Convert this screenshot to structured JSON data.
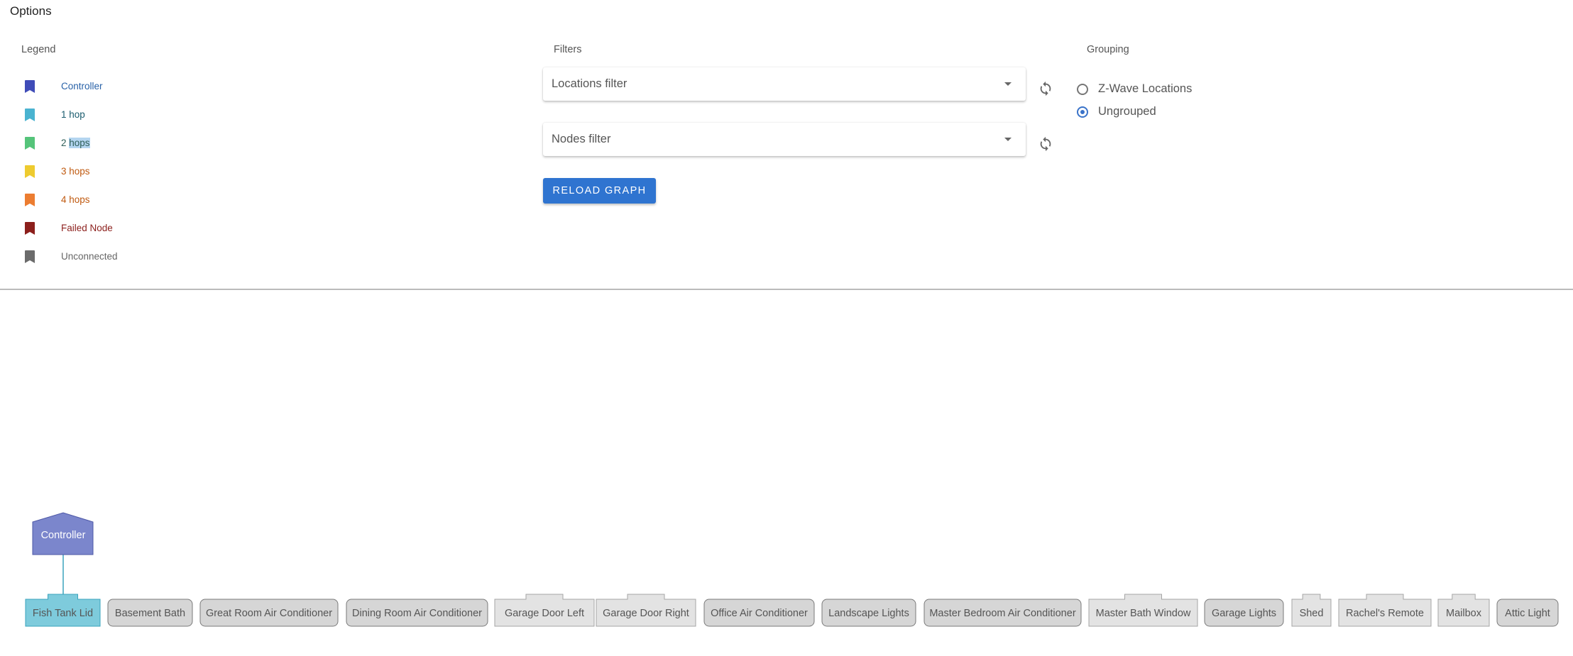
{
  "options_title": "Options",
  "legend": {
    "title": "Legend",
    "items": [
      {
        "label": "Controller",
        "color": "#3f4cb8",
        "text_color": "#2962a8"
      },
      {
        "label": "1 hop",
        "color": "#4ab3d0",
        "text_color": "#1a5c6e"
      },
      {
        "label": "2 ",
        "label_highlight": "hops",
        "color": "#55c47a",
        "text_color": "#2e5e58"
      },
      {
        "label": "3 hops",
        "color": "#eecb2f",
        "text_color": "#c05a10"
      },
      {
        "label": "4 hops",
        "color": "#ec7d31",
        "text_color": "#c05a10"
      },
      {
        "label": "Failed Node",
        "color": "#8c1f1c",
        "text_color": "#8c1f1c"
      },
      {
        "label": "Unconnected",
        "color": "#6b6b6b",
        "text_color": "#666666"
      }
    ]
  },
  "filters": {
    "title": "Filters",
    "locations_placeholder": "Locations filter",
    "nodes_placeholder": "Nodes filter",
    "reload_label": "RELOAD GRAPH"
  },
  "grouping": {
    "title": "Grouping",
    "options": [
      {
        "label": "Z-Wave Locations",
        "checked": false
      },
      {
        "label": "Ungrouped",
        "checked": true
      }
    ]
  },
  "graph": {
    "controller": {
      "label": "Controller",
      "color": "#7b86cc",
      "border": "#4e58a6"
    },
    "nodes": [
      {
        "label": "Fish Tank Lid",
        "style": "connected"
      },
      {
        "label": "Basement Bath",
        "style": "round"
      },
      {
        "label": "Great Room Air Conditioner",
        "style": "round"
      },
      {
        "label": "Dining Room Air Conditioner",
        "style": "round"
      },
      {
        "label": "Garage Door Left",
        "style": "tab"
      },
      {
        "label": "Garage Door Right",
        "style": "tab"
      },
      {
        "label": "Office Air Conditioner",
        "style": "round"
      },
      {
        "label": "Landscape Lights",
        "style": "round"
      },
      {
        "label": "Master Bedroom Air Conditioner",
        "style": "round"
      },
      {
        "label": "Master Bath Window",
        "style": "tab"
      },
      {
        "label": "Garage Lights",
        "style": "round"
      },
      {
        "label": "Shed",
        "style": "tab"
      },
      {
        "label": "Rachel's Remote",
        "style": "tab"
      },
      {
        "label": "Mailbox",
        "style": "tab"
      },
      {
        "label": "Attic Light",
        "style": "round"
      }
    ],
    "colors": {
      "connected_fill": "#7ecbdc",
      "connected_border": "#3aa3bd",
      "unconnected_fill": "#d6d6d6",
      "unconnected_border": "#7a7a7a",
      "tab_fill": "#e3e3e3",
      "tab_border": "#a5a5a5",
      "edge": "#3aa3bd"
    }
  }
}
